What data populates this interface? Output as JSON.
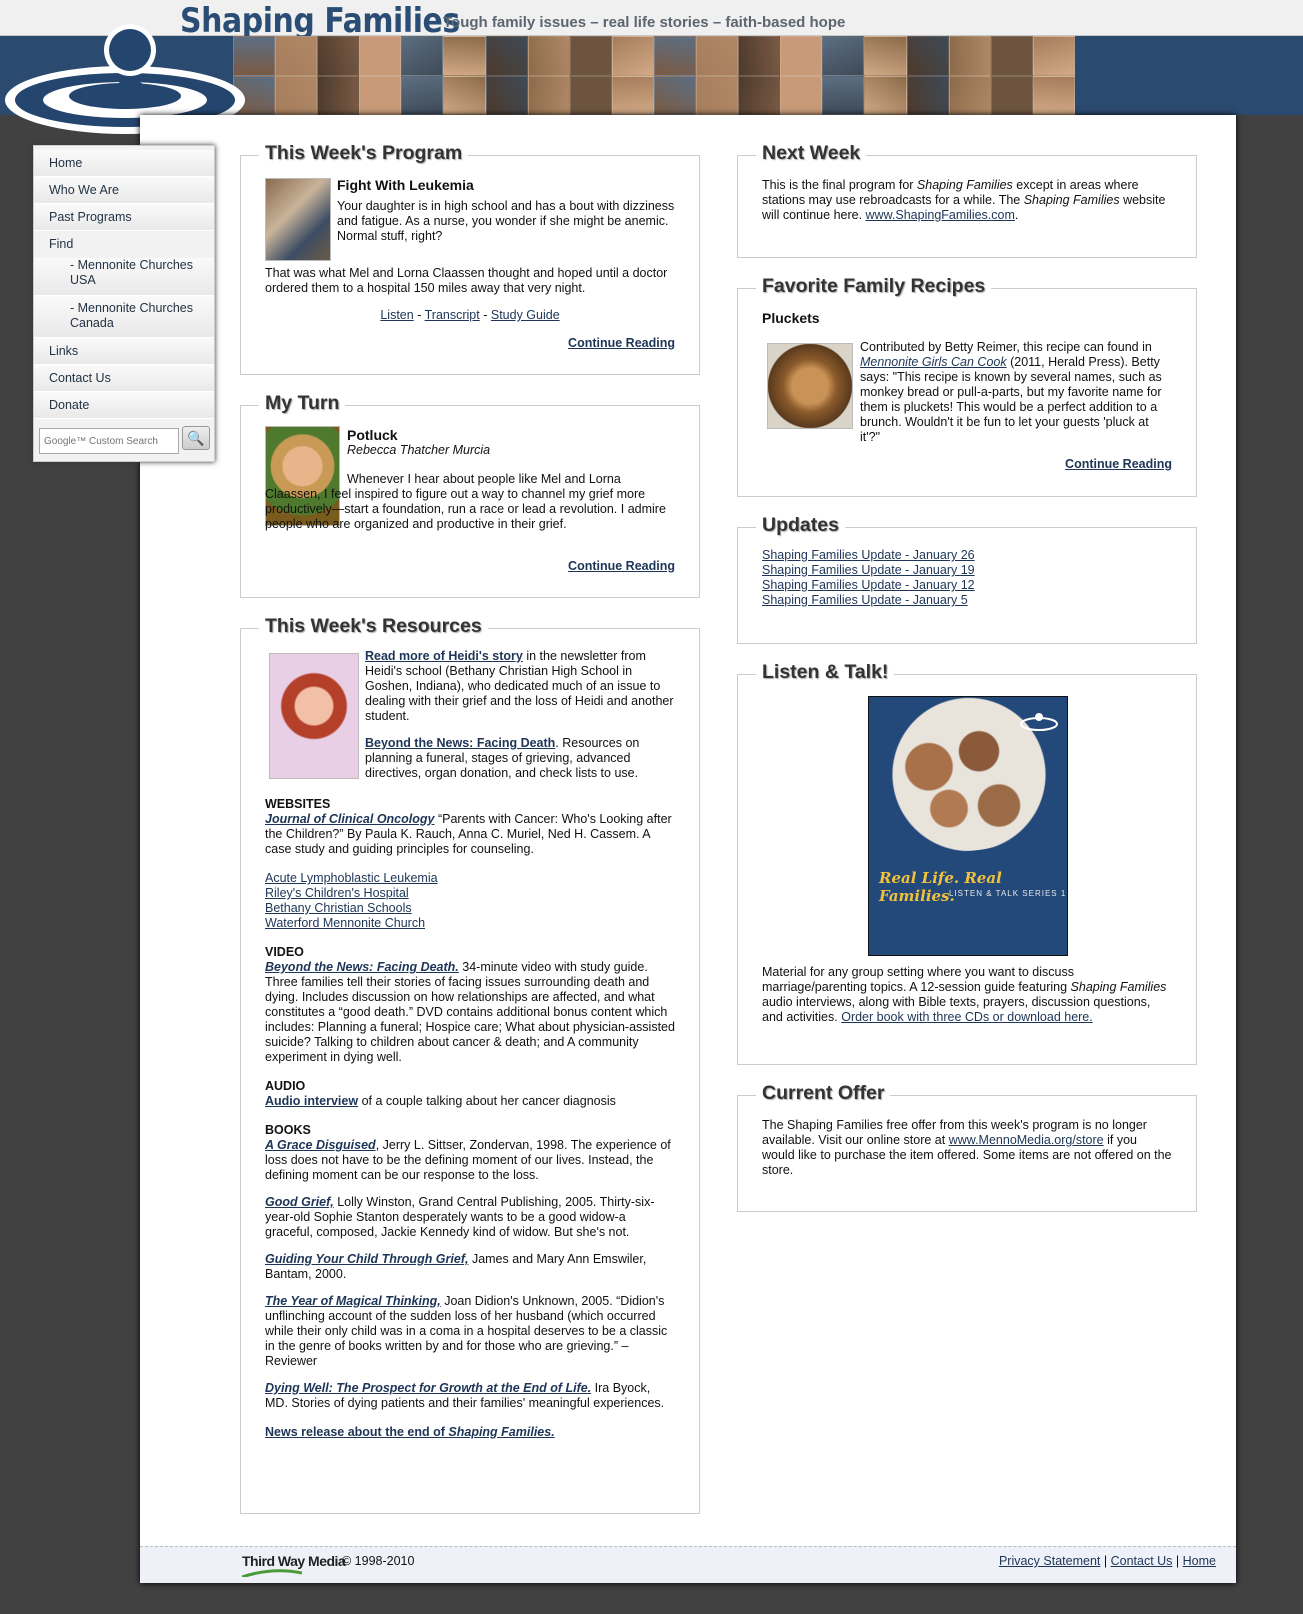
{
  "header": {
    "title": "Shaping Families",
    "tagline": "Tough family issues – real life stories – faith-based hope"
  },
  "colors": {
    "brand": "#2b4a70",
    "link": "#1d3557",
    "page_bg": "#414141"
  },
  "sidebar": {
    "items": [
      {
        "label": "Home"
      },
      {
        "label": "Who We Are"
      },
      {
        "label": "Past Programs"
      },
      {
        "label": "Find"
      },
      {
        "label": "- Mennonite Churches USA"
      },
      {
        "label": "- Mennonite Churches Canada"
      },
      {
        "label": "Links"
      },
      {
        "label": "Contact Us"
      },
      {
        "label": "Donate"
      }
    ],
    "search_placeholder": "Google™ Custom Search"
  },
  "program": {
    "heading": "This Week's Program",
    "title": "Fight With Leukemia",
    "intro": "Your daughter is in high school and has a bout with dizziness and fatigue. As a nurse, you wonder if she might be anemic. Normal stuff, right?",
    "body": "That was what Mel and Lorna Claassen thought and hoped until a doctor ordered them to a hospital 150 miles away that very night.",
    "listen": "Listen",
    "transcript": "Transcript",
    "study_guide": "Study Guide",
    "sep": "-",
    "continue": "Continue Reading"
  },
  "myturn": {
    "heading": "My Turn",
    "title": "Potluck",
    "author": "Rebecca Thatcher Murcia",
    "body": "Whenever I hear about people like Mel and Lorna Claassen, I feel inspired to figure out a way to channel my grief more productively—start a foundation, run a race or lead a revolution. I admire people who are organized and productive in their grief.",
    "continue": "Continue Reading"
  },
  "resources": {
    "heading": "This Week's Resources",
    "heidi_link": "Read more of Heidi's story",
    "heidi_text": "in the newsletter from Heidi's school (Bethany Christian High School in Goshen, Indiana), who dedicated much of an issue to dealing with their grief and the loss of Heidi and another student.",
    "btn_link": "Beyond the News: Facing Death",
    "btn_text": ". Resources on planning a funeral, stages of grieving, advanced directives, organ donation, and check lists to use.",
    "websites_h": "WEBSITES",
    "jco_link": "Journal of Clinical Oncology",
    "jco_text": "“Parents with Cancer: Who's Looking after the Children?” By Paula K. Rauch, Anna C. Muriel, Ned H. Cassem. A case study and guiding principles for counseling.",
    "links": [
      "Acute Lymphoblastic Leukemia",
      "Riley's Children's Hospital",
      "Bethany Christian Schools",
      "Waterford Mennonite Church"
    ],
    "video_h": "VIDEO",
    "video_link": "Beyond the News: Facing Death.",
    "video_text": "34-minute video with study guide. Three families tell their stories of facing issues surrounding death and dying. Includes discussion on how relationships are affected, and what constitutes a “good death.” DVD contains additional bonus content which includes: Planning a funeral; Hospice care; What about physician-assisted suicide? Talking to children about cancer & death; and A community experiment in dying well.",
    "audio_h": "AUDIO",
    "audio_link": "Audio interview",
    "audio_text": "of a couple talking about her cancer diagnosis",
    "books_h": "BOOKS",
    "books": [
      {
        "link": "A Grace Disguised",
        "text": ", Jerry L. Sittser, Zondervan, 1998. The experience of loss does not have to be the defining moment of our lives. Instead, the defining moment can be our response to the loss."
      },
      {
        "link": "Good Grief,",
        "text": " Lolly Winston, Grand Central Publishing, 2005. Thirty-six-year-old Sophie Stanton desperately wants to be a good widow-a graceful, composed, Jackie Kennedy kind of widow. But she's not."
      },
      {
        "link": "Guiding Your Child Through Grief,",
        "text": " James and Mary Ann Emswiler, Bantam, 2000."
      },
      {
        "link": "The Year of Magical Thinking,",
        "text": " Joan Didion's Unknown, 2005. “Didion's unflinching account of the sudden loss of her husband (which occurred while their only child was in a coma in a hospital deserves to be a classic in the genre of books written by and for those who are grieving.” –Reviewer"
      },
      {
        "link": "Dying Well: The Prospect for Growth at the End of Life.",
        "text": " Ira Byock, MD. Stories of dying patients and their families' meaningful experiences."
      }
    ],
    "news_link_a": "News release about the end of ",
    "news_link_b": "Shaping Families."
  },
  "nextweek": {
    "heading": "Next Week",
    "t1": "This is the final program for ",
    "em1": "Shaping Families",
    "t2": " except in areas where stations may use rebroadcasts for a while. The ",
    "em2": "Shaping Families",
    "t3": " website will continue here. ",
    "link": "www.ShapingFamilies.com",
    "t4": "."
  },
  "recipes": {
    "heading": "Favorite Family Recipes",
    "title": "Pluckets",
    "t1": "Contributed by Betty Reimer, this recipe can found in ",
    "link": "Mennonite Girls Can Cook",
    "t2": " (2011, Herald Press). Betty says: \"This recipe is known by several names, such as monkey bread or pull-a-parts, but my favorite name for them is pluckets! This would be a perfect addition to a brunch. Wouldn't it be fun to let your guests 'pluck at it'?\"",
    "continue": "Continue Reading"
  },
  "updates": {
    "heading": "Updates",
    "items": [
      "Shaping Families Update - January 26",
      "Shaping Families Update - January 19",
      "Shaping Families Update - January 12",
      "Shaping Families Update - January 5"
    ]
  },
  "listen": {
    "heading": "Listen & Talk!",
    "cover_title": "Real Life. Real Families.",
    "cover_sub": "LISTEN & TALK SERIES 1",
    "t1": "Material for any group setting where you want to discuss marriage/parenting topics. A 12-session guide featuring ",
    "em": "Shaping Families",
    "t2": " audio interviews, along with Bible texts, prayers, discussion questions, and activities. ",
    "link": "Order book with three CDs or download here."
  },
  "offer": {
    "heading": "Current Offer",
    "t1": "The Shaping Families free offer from this week's program is no longer available. Visit our online store at ",
    "link": "www.MennoMedia.org/store",
    "t2": " if you would like to purchase the item offered. Some items are not offered on the store."
  },
  "footer": {
    "brand": "Third Way Media",
    "copyright": "© 1998-2010",
    "privacy": "Privacy Statement",
    "contact": "Contact Us",
    "home": "Home",
    "sep": "|"
  }
}
